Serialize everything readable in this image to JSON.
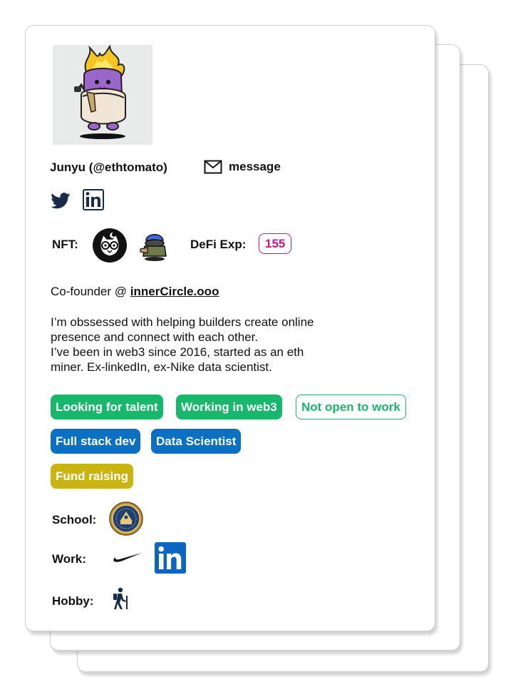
{
  "profile": {
    "name": "Junyu (@ethtomato)",
    "message_label": "message",
    "nft_label": "NFT:",
    "defi_label": "DeFi Exp:",
    "defi_value": "155",
    "role_prefix": "Co-founder @ ",
    "role_company": "innerCircle.ooo",
    "bio": [
      "I’m obssessed with helping builders create online",
      "presence and connect with each other.",
      "I’ve been in web3 since 2016, started as an eth",
      "miner. Ex-linkedIn, ex-Nike data scientist."
    ]
  },
  "social": {
    "icons": [
      "twitter-icon",
      "linkedin-icon"
    ]
  },
  "nfts": {
    "icons": [
      "owl-nft-icon",
      "hooded-character-nft-icon"
    ]
  },
  "tags": {
    "looking": "Looking for talent",
    "working": "Working in web3",
    "not_open": "Not open to work",
    "full_stack": "Full stack dev",
    "data_scientist": "Data Scientist",
    "fund_raising": "Fund raising"
  },
  "colors": {
    "tag_green": "#16b86b",
    "tag_blue": "#0a70c4",
    "tag_olive": "#c9b410",
    "defi_accent": "#c2188a",
    "linkedin_blue": "#0a66c2",
    "twitter_navy": "#1a2b4a"
  },
  "details": {
    "school_label": "School:",
    "work_label": "Work:",
    "hobby_label": "Hobby:",
    "school_icon": "university-seal-icon",
    "work_icons": [
      "nike-swoosh-icon",
      "linkedin-icon"
    ],
    "hobby_icon": "hiking-icon"
  }
}
